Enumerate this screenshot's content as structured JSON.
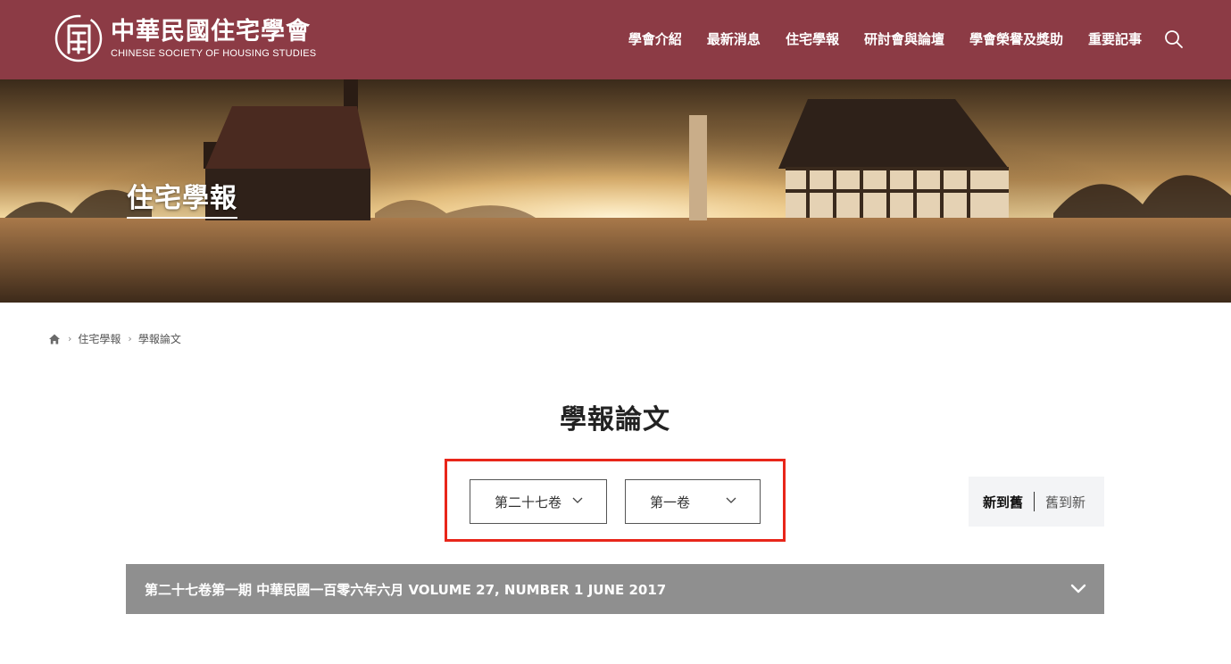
{
  "header": {
    "logo_cn": "中華民國住宅學會",
    "logo_en": "CHINESE SOCIETY OF HOUSING STUDIES",
    "nav": [
      "學會介紹",
      "最新消息",
      "住宅學報",
      "研討會與論壇",
      "學會榮譽及獎助",
      "重要記事"
    ],
    "search_icon": "search-icon",
    "bg_color": "#8c3b45"
  },
  "banner": {
    "title": "住宅學報"
  },
  "breadcrumb": {
    "home_icon": "home-icon",
    "items": [
      "住宅學報",
      "學報論文"
    ]
  },
  "page": {
    "title": "學報論文"
  },
  "filters": {
    "volume_selected": "第二十七卷",
    "issue_selected": "第一卷",
    "highlight_color": "#e8261a"
  },
  "sort": {
    "new_to_old": "新到舊",
    "old_to_new": "舊到新"
  },
  "issues": [
    {
      "title": "第二十七卷第一期 中華民國一百零六年六月 VOLUME 27, NUMBER 1 JUNE 2017"
    }
  ]
}
